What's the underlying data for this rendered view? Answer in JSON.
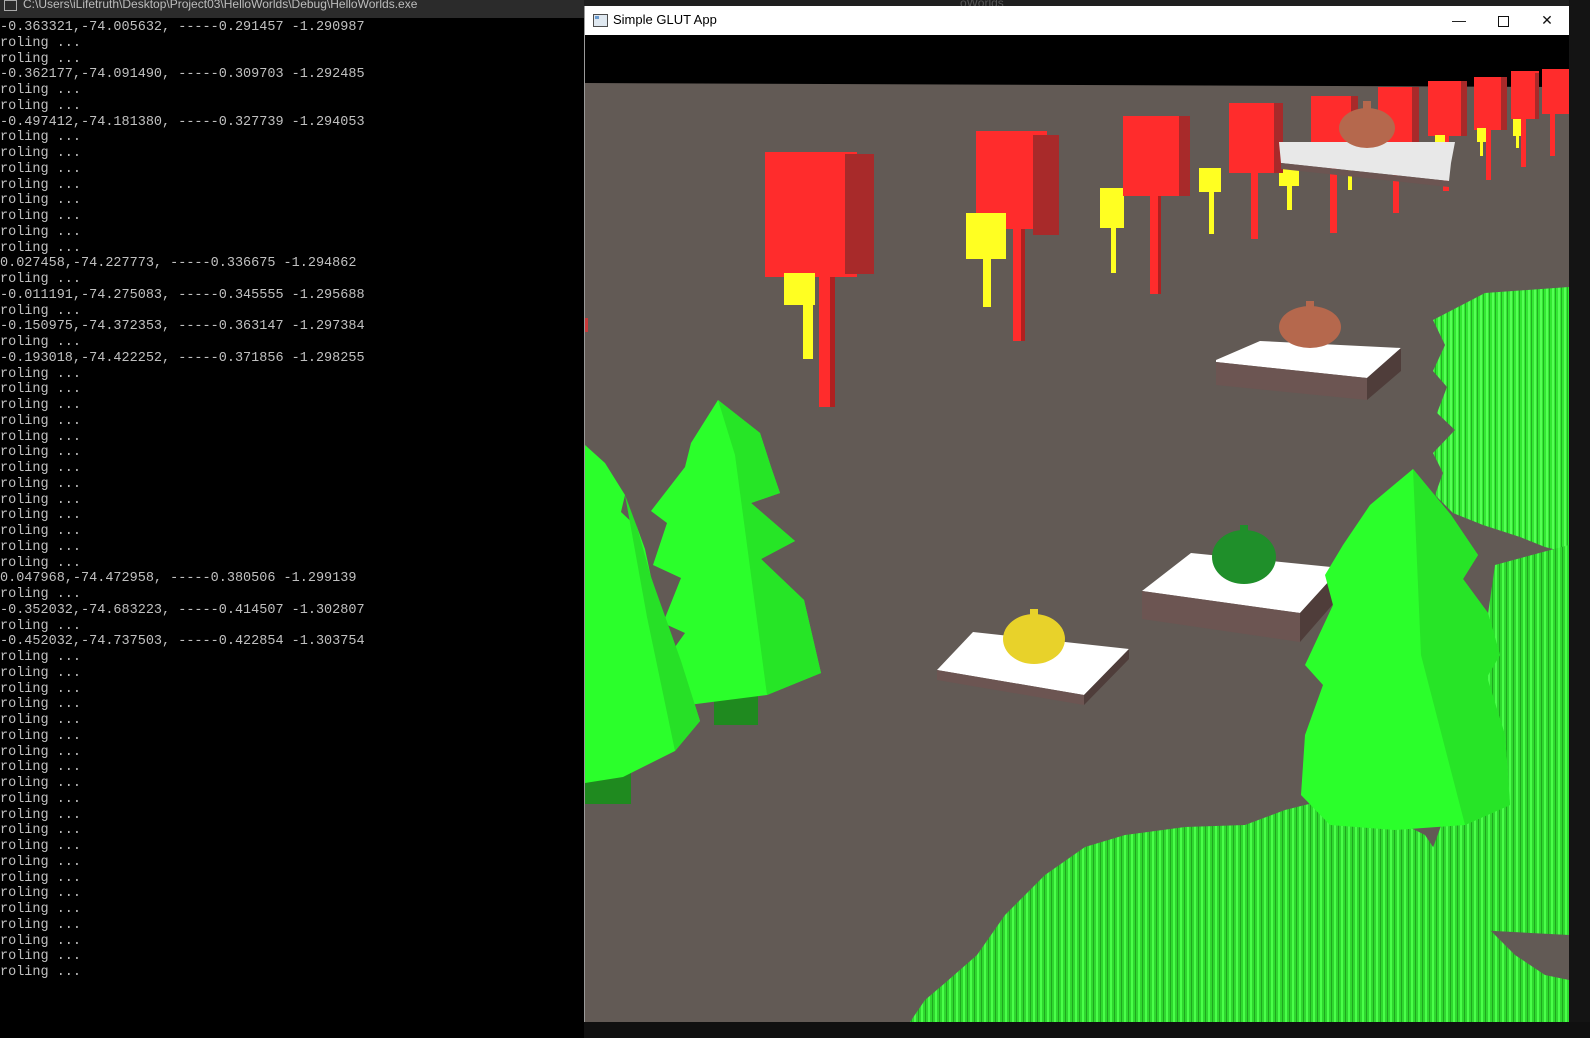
{
  "console": {
    "title": "C:\\Users\\iLifetruth\\Desktop\\Project03\\HelloWorlds\\Debug\\HelloWorlds.exe",
    "lines": [
      "-0.363321,-74.005632, -----0.291457 -1.290987",
      "roling ...",
      "roling ...",
      "-0.362177,-74.091490, -----0.309703 -1.292485",
      "roling ...",
      "roling ...",
      "-0.497412,-74.181380, -----0.327739 -1.294053",
      "roling ...",
      "roling ...",
      "roling ...",
      "roling ...",
      "roling ...",
      "roling ...",
      "roling ...",
      "roling ...",
      "0.027458,-74.227773, -----0.336675 -1.294862",
      "roling ...",
      "-0.011191,-74.275083, -----0.345555 -1.295688",
      "roling ...",
      "-0.150975,-74.372353, -----0.363147 -1.297384",
      "roling ...",
      "-0.193018,-74.422252, -----0.371856 -1.298255",
      "roling ...",
      "roling ...",
      "roling ...",
      "roling ...",
      "roling ...",
      "roling ...",
      "roling ...",
      "roling ...",
      "roling ...",
      "roling ...",
      "roling ...",
      "roling ...",
      "roling ...",
      "0.047968,-74.472958, -----0.380506 -1.299139",
      "roling ...",
      "-0.352032,-74.683223, -----0.414507 -1.302807",
      "roling ...",
      "-0.452032,-74.737503, -----0.422854 -1.303754",
      "roling ...",
      "roling ...",
      "roling ...",
      "roling ...",
      "roling ...",
      "roling ...",
      "roling ...",
      "roling ...",
      "roling ...",
      "roling ...",
      "roling ...",
      "roling ...",
      "roling ...",
      "roling ...",
      "roling ...",
      "roling ...",
      "roling ...",
      "roling ...",
      "roling ...",
      "roling ...",
      "roling ..."
    ]
  },
  "background_window": {
    "title_fragment": "oWorlds"
  },
  "glut_window": {
    "title": "Simple GLUT App",
    "minimize_glyph": "—",
    "close_glyph": "✕"
  },
  "scene": {
    "ground_color": "#625a55",
    "sign_color": "#ff3030",
    "pole_color": "#ffff22",
    "tree_color": "#2bff2b",
    "grass_color": "#33ee33",
    "teapots": [
      {
        "color": "#e8d22a"
      },
      {
        "color": "#1f8f2a"
      },
      {
        "color": "#b5684d"
      },
      {
        "color": "#b5684d"
      }
    ]
  }
}
